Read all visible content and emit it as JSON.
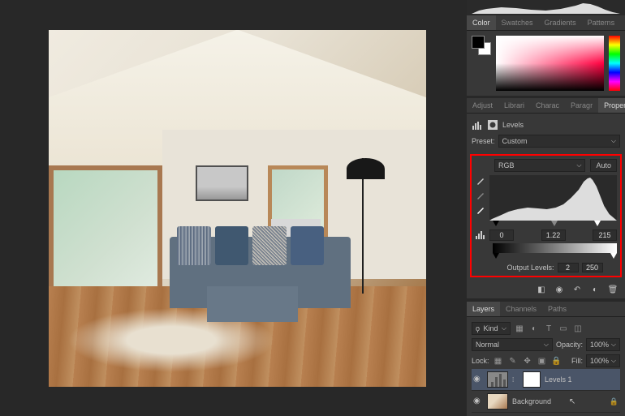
{
  "color_panel": {
    "tabs": [
      "Color",
      "Swatches",
      "Gradients",
      "Patterns"
    ],
    "active": "Color"
  },
  "properties_panel": {
    "tabs": [
      "Adjust",
      "Librari",
      "Charac",
      "Paragr",
      "Properties"
    ],
    "active": "Properties",
    "type_label": "Levels",
    "preset_label": "Preset:",
    "preset_value": "Custom",
    "channel": "RGB",
    "auto_btn": "Auto",
    "input_black": "0",
    "input_gamma": "1.22",
    "input_white": "215",
    "output_label": "Output Levels:",
    "output_black": "2",
    "output_white": "250"
  },
  "layers_panel": {
    "tabs": [
      "Layers",
      "Channels",
      "Paths"
    ],
    "active": "Layers",
    "kind_label": "Kind",
    "blend_mode": "Normal",
    "opacity_label": "Opacity:",
    "opacity_value": "100%",
    "lock_label": "Lock:",
    "fill_label": "Fill:",
    "fill_value": "100%",
    "layers": [
      {
        "name": "Levels 1",
        "visible": true,
        "selected": true,
        "adjustment": true
      },
      {
        "name": "Background",
        "visible": true,
        "selected": false,
        "locked": true
      }
    ]
  }
}
